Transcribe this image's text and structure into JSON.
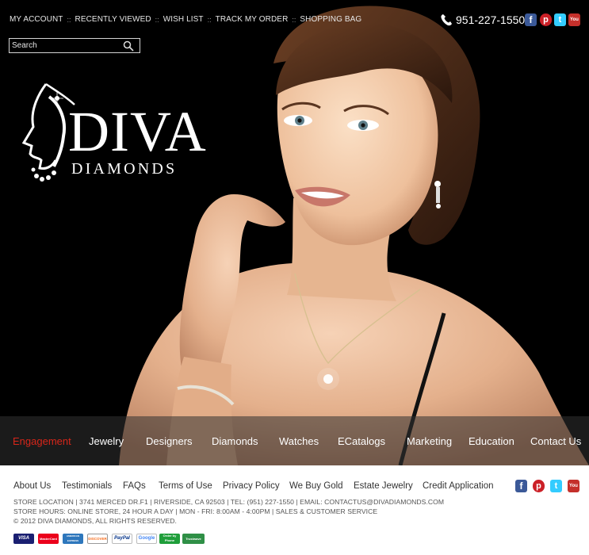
{
  "colors": {
    "background": "#000000",
    "nav_active": "#d7261a",
    "facebook": "#3b5998",
    "pinterest": "#cb2027",
    "twitter": "#33ccff",
    "youtube": "#c4302b"
  },
  "top_nav": {
    "items": [
      "MY ACCOUNT",
      "RECENTLY VIEWED",
      "WISH LIST",
      "TRACK MY ORDER",
      "SHOPPING BAG"
    ],
    "separator": "::"
  },
  "phone": {
    "icon": "phone-icon",
    "number": "951-227-1550"
  },
  "social": [
    {
      "name": "facebook",
      "glyph": "f",
      "icon": "facebook-icon"
    },
    {
      "name": "pinterest",
      "glyph": "p",
      "icon": "pinterest-icon"
    },
    {
      "name": "twitter",
      "glyph": "t",
      "icon": "twitter-icon"
    },
    {
      "name": "youtube",
      "glyph": "You",
      "icon": "youtube-icon"
    }
  ],
  "search": {
    "placeholder": "Search",
    "icon": "search-icon"
  },
  "logo": {
    "name": "DIVA",
    "subtitle": "DIAMONDS"
  },
  "main_nav": {
    "items": [
      "Engagement",
      "Jewelry",
      "Designers",
      "Diamonds",
      "Watches",
      "ECatalogs",
      "Marketing",
      "Education",
      "Contact Us"
    ],
    "active": "Engagement"
  },
  "footer": {
    "links": [
      "About Us",
      "Testimonials",
      "FAQs",
      "Terms of Use",
      "Privacy Policy",
      "We Buy Gold",
      "Estate Jewelry",
      "Credit Application"
    ],
    "location": "STORE LOCATION | 3741 MERCED DR.F1 | RIVERSIDE,  CA  92503 | TEL: (951) 227-1550 | EMAIL: CONTACTUS@DIVADIAMONDS.COM",
    "hours": "STORE HOURS: ONLINE STORE, 24 HOUR A DAY | MON - FRI: 8:00AM - 4:00PM | SALES & CUSTOMER SERVICE",
    "copyright": "© 2012 DIVA DIAMONDS, ALL RIGHTS RESERVED.",
    "payments": [
      "VISA",
      "MasterCard",
      "AMERICAN EXPRESS",
      "DISCOVER",
      "PayPal",
      "Google",
      "Order by Phone",
      "Trustwave"
    ]
  }
}
